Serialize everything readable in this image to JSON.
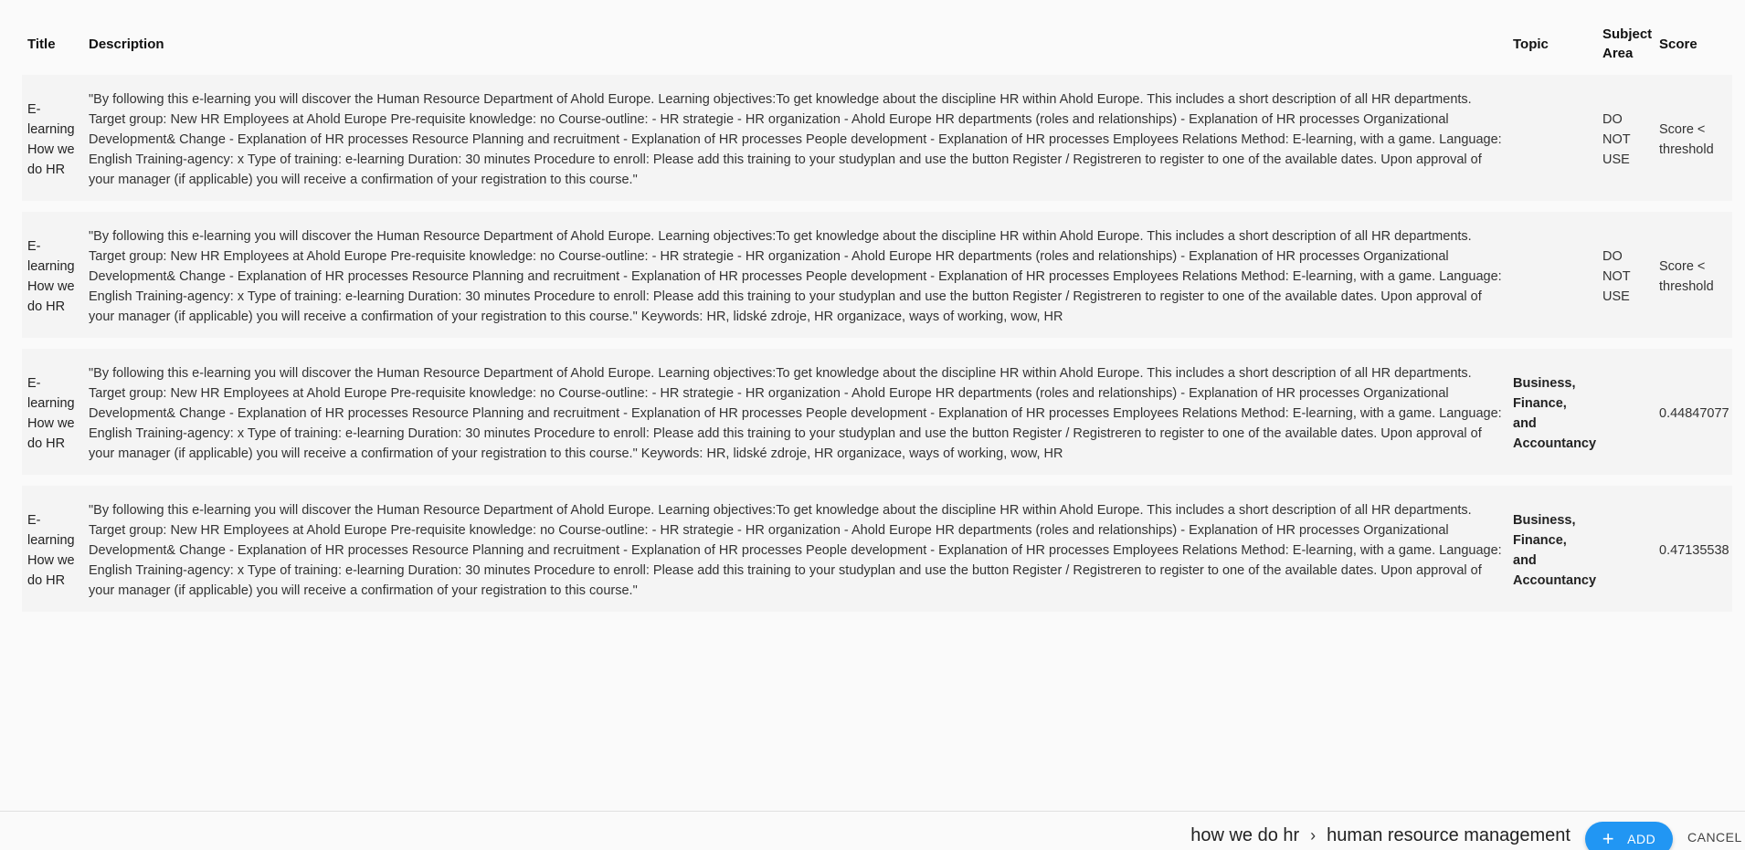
{
  "table": {
    "headers": {
      "title": "Title",
      "description": "Description",
      "topic": "Topic",
      "subject_area": "Subject Area",
      "score": "Score"
    },
    "rows": [
      {
        "title": "E-learning How we do HR",
        "description": "\"By following this e-learning you will discover the Human Resource Department of Ahold Europe.  Learning objectives:To get knowledge about the discipline HR within Ahold Europe. This includes a short description of all HR departments.  Target group: New HR Employees at Ahold Europe  Pre-requisite knowledge: no  Course-outline: - HR strategie - HR organization - Ahold Europe HR departments (roles and relationships) - Explanation of HR processes Organizational Development& Change - Explanation of HR processes Resource Planning and recruitment - Explanation of HR processes People development - Explanation of HR processes Employees Relations  Method: E-learning, with a game.  Language: English  Training-agency: x Type of training: e-learning  Duration: 30 minutes  Procedure to enroll: Please add this training to your studyplan and use the button Register / Registreren to register to one of the available dates. Upon approval of your manager (if applicable) you will receive a confirmation of your registration to this course.\"",
        "topic": "",
        "subject_area": "DO NOT USE",
        "score": "Score < threshold"
      },
      {
        "title": "E-learning How we do HR",
        "description": " \"By following this e-learning you will discover the Human Resource Department of Ahold Europe.  Learning objectives:To get knowledge about the discipline HR within Ahold Europe. This includes a short description of all HR departments.  Target group: New HR Employees at Ahold Europe  Pre-requisite knowledge: no  Course-outline: - HR strategie - HR organization - Ahold Europe HR departments (roles and relationships) - Explanation of HR processes Organizational Development& Change - Explanation of HR processes Resource Planning and recruitment - Explanation of HR processes People development - Explanation of HR processes Employees Relations  Method: E-learning, with a game.  Language: English  Training-agency: x Type of training: e-learning  Duration: 30 minutes  Procedure to enroll: Please add this training to your studyplan and use the button Register / Registreren to register to one of the available dates. Upon approval of your manager (if applicable) you will receive a confirmation of your registration to this course.\"   Keywords: HR, lidské zdroje, HR organizace, ways of working, wow, HR",
        "topic": "",
        "subject_area": "DO NOT USE",
        "score": "Score < threshold"
      },
      {
        "title": "E-learning How we do HR",
        "description": " \"By following this e-learning you will discover the Human Resource Department of Ahold Europe.  Learning objectives:To get knowledge about the discipline HR within Ahold Europe. This includes a short description of all HR departments.  Target group: New HR Employees at Ahold Europe  Pre-requisite knowledge: no  Course-outline: - HR strategie - HR organization - Ahold Europe HR departments (roles and relationships) - Explanation of HR processes Organizational Development& Change - Explanation of HR processes Resource Planning and recruitment - Explanation of HR processes People development - Explanation of HR processes Employees Relations  Method: E-learning, with a game.  Language: English  Training-agency: x Type of training: e-learning  Duration: 30 minutes  Procedure to enroll: Please add this training to your studyplan and use the button Register / Registreren to register to one of the available dates. Upon approval of your manager (if applicable) you will receive a confirmation of your registration to this course.\"   Keywords: HR, lidské zdroje, HR organizace, ways of working, wow, HR",
        "topic": "Business, Finance, and Accountancy",
        "subject_area": "",
        "score": "0.44847077"
      },
      {
        "title": "E-learning How we do HR",
        "description": " \"By following this e-learning you will discover the Human Resource Department of Ahold Europe.  Learning objectives:To get knowledge about the discipline HR within Ahold Europe. This includes a short description of all HR departments.  Target group: New HR Employees at Ahold Europe  Pre-requisite knowledge: no  Course-outline: - HR strategie - HR organization - Ahold Europe HR departments (roles and relationships) - Explanation of HR processes Organizational Development& Change - Explanation of HR processes Resource Planning and recruitment - Explanation of HR processes People development - Explanation of HR processes Employees Relations  Method: E-learning, with a game.  Language: English  Training-agency: x Type of training: e-learning  Duration: 30 minutes  Procedure to enroll: Please add this training to your studyplan and use the button Register / Registreren to register to one of the available dates. Upon approval of your manager (if applicable) you will receive a confirmation of your registration to this course.\"",
        "topic": "Business, Finance, and Accountancy",
        "subject_area": "",
        "score": "0.47135538"
      }
    ]
  },
  "footer": {
    "breadcrumb": [
      "how we do hr",
      "human resource management"
    ],
    "separator": "›",
    "add_label": "ADD",
    "add_icon": "+",
    "cancel_label": "CANCEL",
    "accent_color": "#2196f3"
  }
}
